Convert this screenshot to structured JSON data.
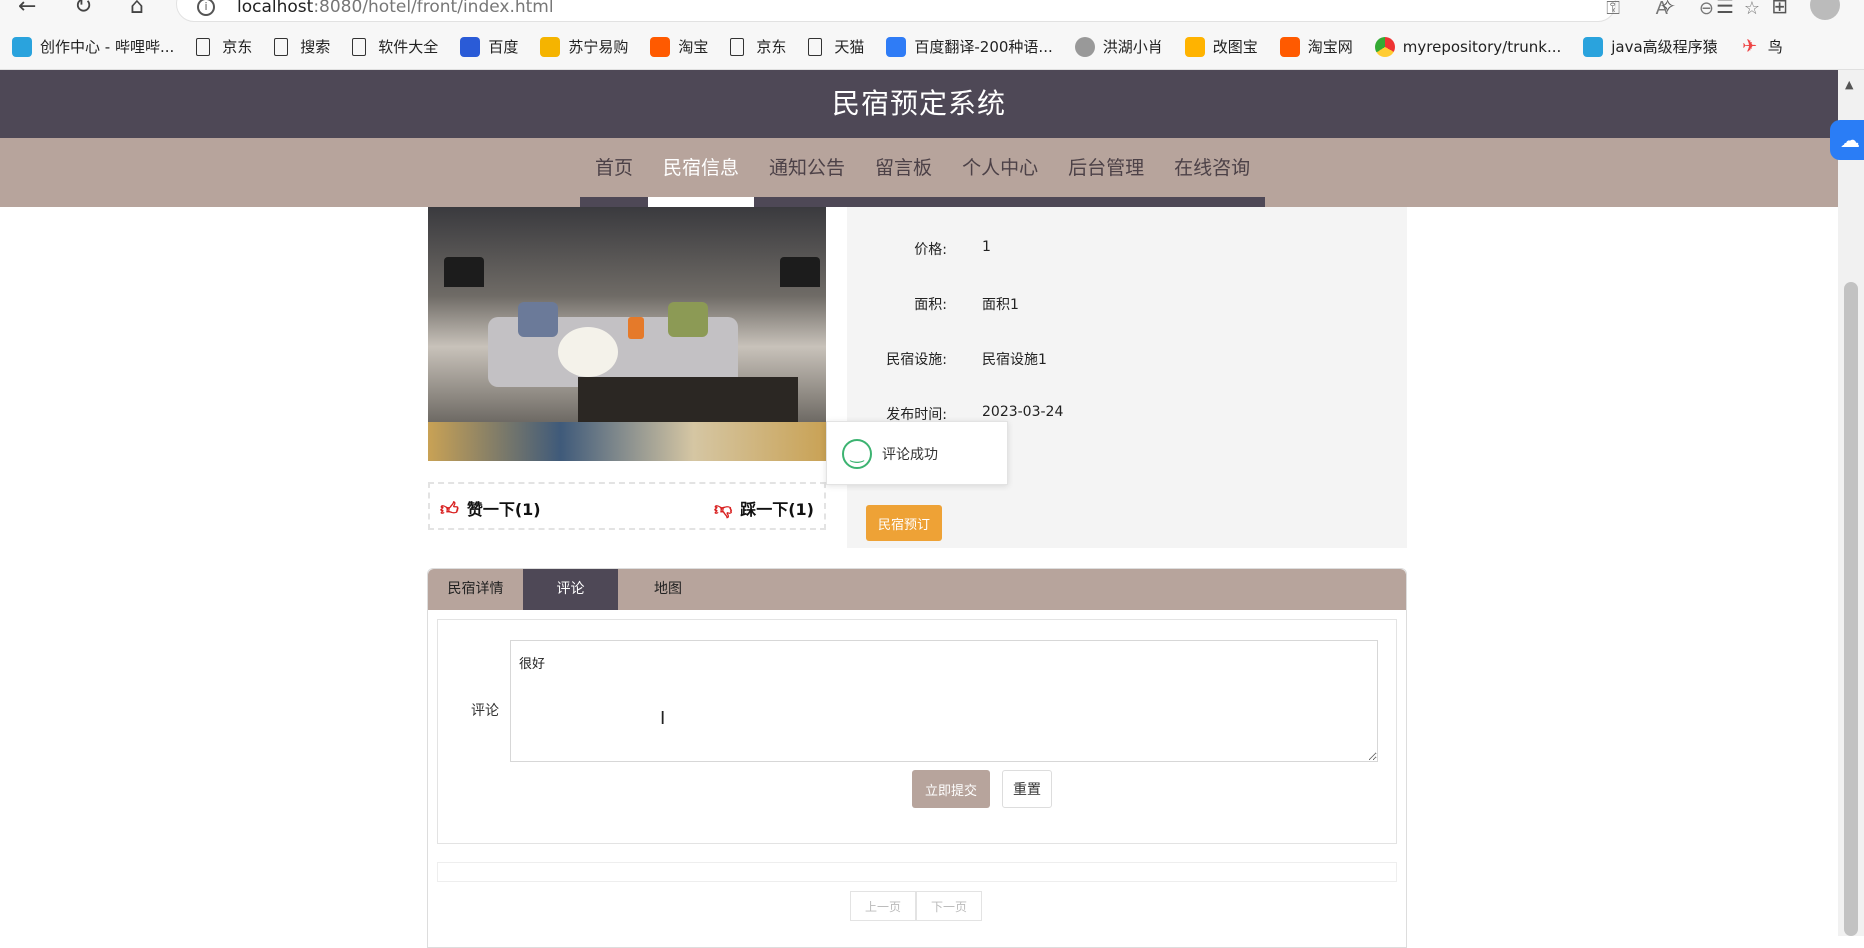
{
  "browser": {
    "url_host": "localhost",
    "url_rest": ":8080/hotel/front/index.html",
    "bookmarks": [
      {
        "label": "创作中心 - 哔哩哔...",
        "icon": "bilibili-icon",
        "cls": "bili"
      },
      {
        "label": "京东",
        "icon": "page-icon",
        "cls": "page"
      },
      {
        "label": "搜索",
        "icon": "page-icon",
        "cls": "page"
      },
      {
        "label": "软件大全",
        "icon": "page-icon",
        "cls": "page"
      },
      {
        "label": "百度",
        "icon": "baidu-icon",
        "cls": "baidu"
      },
      {
        "label": "苏宁易购",
        "icon": "suning-icon",
        "cls": "suning"
      },
      {
        "label": "淘宝",
        "icon": "taobao-icon",
        "cls": "taobao"
      },
      {
        "label": "京东",
        "icon": "page-icon",
        "cls": "page"
      },
      {
        "label": "天猫",
        "icon": "page-icon",
        "cls": "page"
      },
      {
        "label": "百度翻译-200种语...",
        "icon": "fanyi-icon",
        "cls": "fanyi"
      },
      {
        "label": "洪湖小肖",
        "icon": "avatar-icon",
        "cls": "hong"
      },
      {
        "label": "改图宝",
        "icon": "gaitubao-icon",
        "cls": "gaitu"
      },
      {
        "label": "淘宝网",
        "icon": "taobao-icon",
        "cls": "taobao"
      },
      {
        "label": "myrepository/trunk...",
        "icon": "chrome-icon",
        "cls": "chrome"
      },
      {
        "label": "java高级程序猿",
        "icon": "bilibili-icon",
        "cls": "bili"
      },
      {
        "label": "鸟",
        "icon": "bird-icon",
        "cls": "bird"
      }
    ]
  },
  "site": {
    "title": "民宿预定系统",
    "nav": [
      {
        "label": "首页",
        "active": false
      },
      {
        "label": "民宿信息",
        "active": true
      },
      {
        "label": "通知公告",
        "active": false
      },
      {
        "label": "留言板",
        "active": false
      },
      {
        "label": "个人中心",
        "active": false
      },
      {
        "label": "后台管理",
        "active": false
      },
      {
        "label": "在线咨询",
        "active": false
      }
    ]
  },
  "detail": {
    "like_label": "赞一下(1)",
    "dislike_label": "踩一下(1)",
    "fields": [
      {
        "label": "价格:",
        "value": "1"
      },
      {
        "label": "面积:",
        "value": "面积1"
      },
      {
        "label": "民宿设施:",
        "value": "民宿设施1"
      },
      {
        "label": "发布时间:",
        "value": "2023-03-24"
      }
    ],
    "book_button": "民宿预订"
  },
  "toast": {
    "message": "评论成功"
  },
  "tabs": [
    {
      "label": "民宿详情",
      "active": false
    },
    {
      "label": "评论",
      "active": true
    },
    {
      "label": "地图",
      "active": false
    }
  ],
  "comment": {
    "label": "评论",
    "value": "很好",
    "submit": "立即提交",
    "reset": "重置"
  },
  "pager": {
    "prev": "上一页",
    "next": "下一页"
  },
  "colors": {
    "header": "#4e4856",
    "nav": "#b7a49c",
    "accent": "#eea236",
    "success": "#3cb371"
  }
}
